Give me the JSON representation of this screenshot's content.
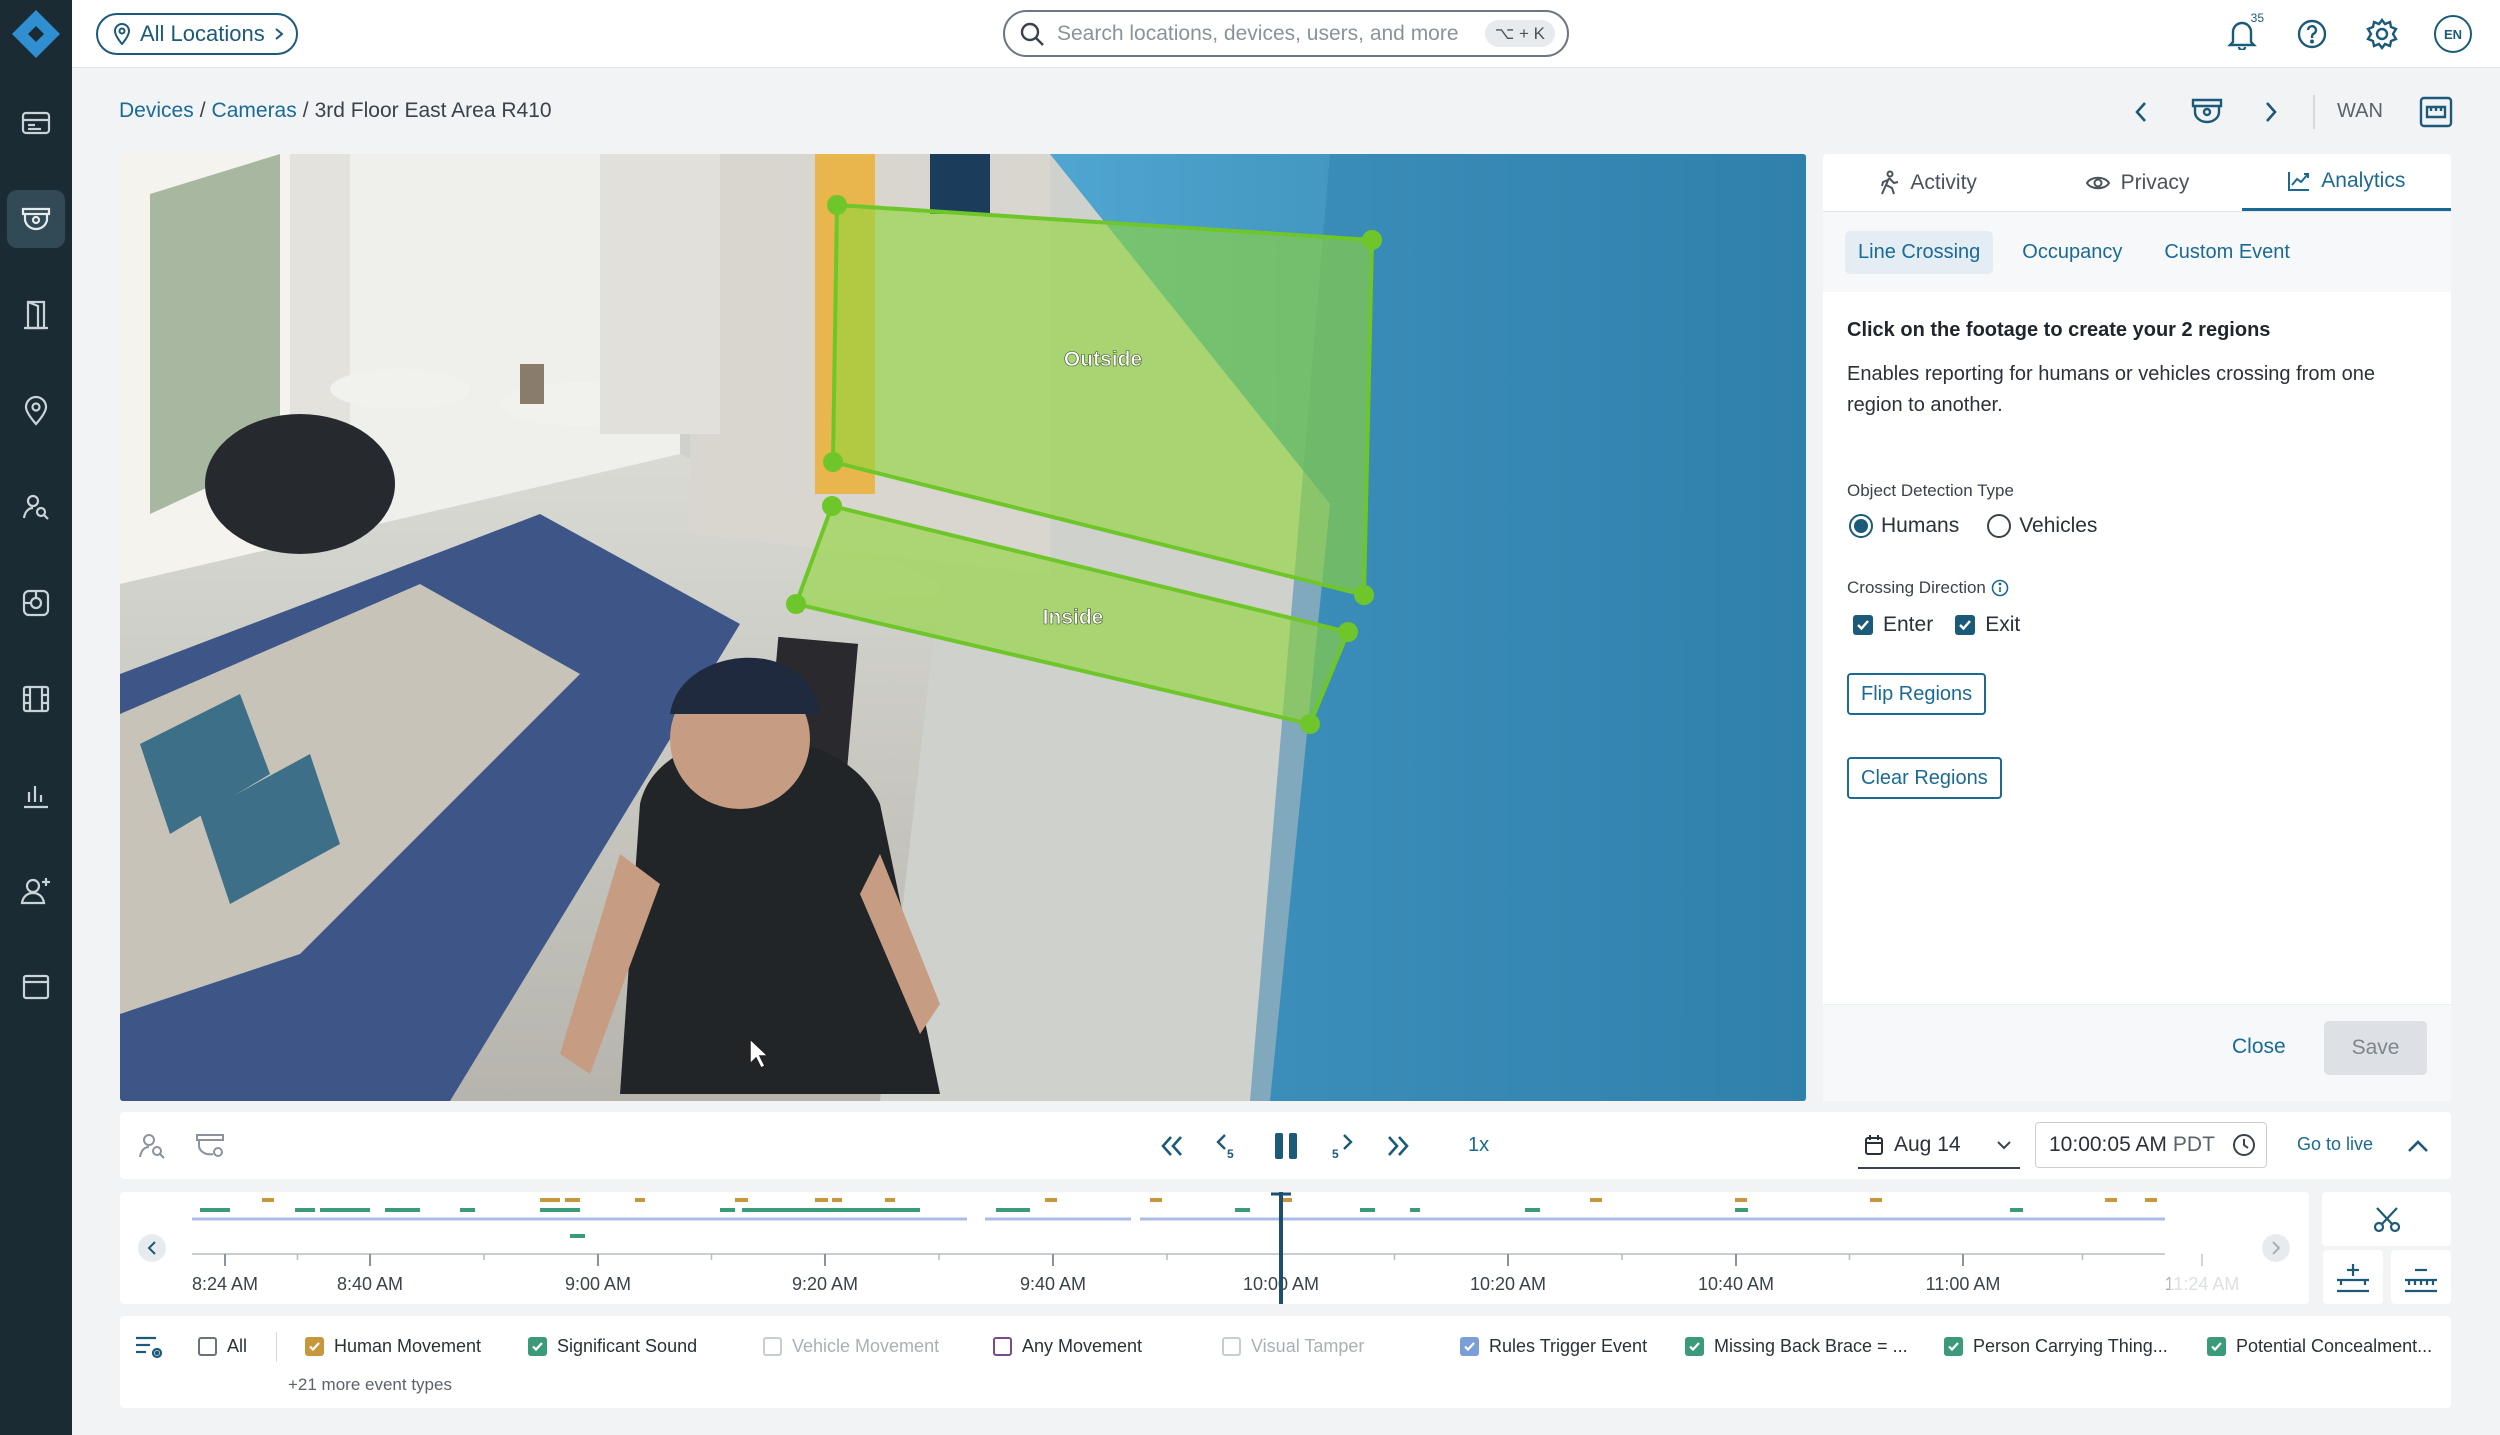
{
  "topbar": {
    "location_label": "All Locations",
    "search_placeholder": "Search locations, devices, users, and more",
    "search_shortcut": "⌥ + K",
    "notifications_count": "35",
    "language": "EN"
  },
  "sidebar": {
    "items": [
      "dashboard",
      "devices",
      "access",
      "locations",
      "people-search",
      "integrations",
      "archives",
      "reports",
      "users",
      "apps"
    ],
    "active": "devices"
  },
  "breadcrumb": {
    "devices": "Devices",
    "sep": "/",
    "cameras": "Cameras",
    "current": "3rd Floor East Area R410"
  },
  "device_nav": {
    "network_label": "WAN"
  },
  "video": {
    "region_outside": "Outside",
    "region_inside": "Inside",
    "region_color": "#8fd63a"
  },
  "panel": {
    "tabs": [
      "Activity",
      "Privacy",
      "Analytics"
    ],
    "active_tab": "Analytics",
    "subtabs": [
      "Line Crossing",
      "Occupancy",
      "Custom Event"
    ],
    "active_subtab": "Line Crossing",
    "title": "Click on the footage to create your 2 regions",
    "description": "Enables reporting for humans or vehicles crossing from one region to another.",
    "detection_label": "Object Detection Type",
    "detection_options": [
      "Humans",
      "Vehicles"
    ],
    "detection_selected": "Humans",
    "direction_label": "Crossing Direction",
    "direction_options": [
      "Enter",
      "Exit"
    ],
    "flip_label": "Flip Regions",
    "clear_label": "Clear Regions",
    "close_label": "Close",
    "save_label": "Save"
  },
  "controls": {
    "speed": "1x",
    "date": "Aug 14",
    "time": "10:00:05 AM",
    "timezone": "PDT",
    "go_live": "Go to live"
  },
  "timeline": {
    "ticks": [
      "8:24 AM",
      "8:40 AM",
      "9:00 AM",
      "9:20 AM",
      "9:40 AM",
      "10:00 AM",
      "10:20 AM",
      "10:40 AM",
      "11:00 AM",
      "11:24 AM"
    ]
  },
  "filters": {
    "items": [
      {
        "label": "All",
        "state": "off",
        "color": "#6a7379"
      },
      {
        "label": "Human Movement",
        "state": "on",
        "color": "#c8963c"
      },
      {
        "label": "Significant Sound",
        "state": "on",
        "color": "#3a9a7a"
      },
      {
        "label": "Vehicle Movement",
        "state": "disabled",
        "color": "#c8cdd1"
      },
      {
        "label": "Any Movement",
        "state": "off",
        "color": "#7a4a8a"
      },
      {
        "label": "Visual Tamper",
        "state": "disabled",
        "color": "#c8cdd1"
      },
      {
        "label": "Rules Trigger Event",
        "state": "on",
        "color": "#7a9ed8"
      },
      {
        "label": "Missing Back Brace = ...",
        "state": "on",
        "color": "#3a9a7a"
      },
      {
        "label": "Person Carrying Thing...",
        "state": "on",
        "color": "#3a9a7a"
      },
      {
        "label": "Potential Concealment...",
        "state": "on",
        "color": "#3a9a7a"
      }
    ],
    "more_label": "+21 more event types"
  }
}
